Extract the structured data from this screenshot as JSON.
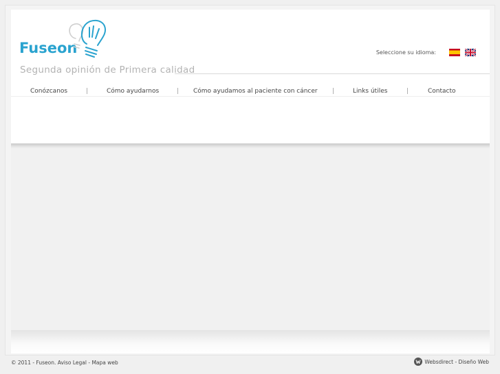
{
  "header": {
    "logo_text": "Fuseon",
    "tagline": "Segunda opinión de Primera calidad",
    "language_label": "Seleccione su idioma:"
  },
  "nav": {
    "items": [
      {
        "label": "Conózcanos"
      },
      {
        "label": "Cómo ayudarnos"
      },
      {
        "label": "Cómo ayudamos al paciente con cáncer"
      },
      {
        "label": "Links útiles"
      },
      {
        "label": "Contacto"
      }
    ],
    "separator": "|"
  },
  "footer": {
    "copyright": "© 2011 - Fuseon.",
    "legal_link": "Aviso Legal",
    "dash": "-",
    "sitemap_link": "Mapa web",
    "credit_link": "Websdirect - Diseño Web"
  },
  "colors": {
    "brand": "#2aa3cf",
    "tagline": "#b3b3b3"
  }
}
